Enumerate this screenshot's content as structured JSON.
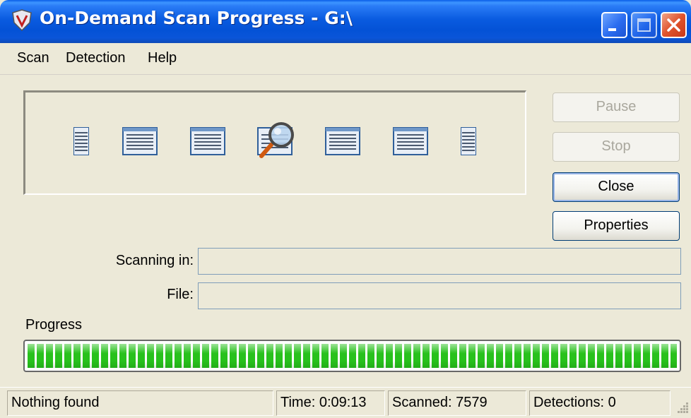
{
  "window": {
    "title": "On-Demand Scan Progress - G:\\",
    "app_icon": "mcafee-shield-icon",
    "caption_buttons": [
      "minimize-icon",
      "maximize-icon",
      "close-icon"
    ],
    "colors": {
      "titlebar": "#0a5be0",
      "close_button": "#e0532c",
      "face": "#ece9d8"
    }
  },
  "menu": {
    "items": [
      "Scan",
      "Detection",
      "Help"
    ]
  },
  "animation": {
    "icons": [
      "document-icon",
      "document-icon",
      "document-icon",
      "magnifier-document-icon",
      "document-icon",
      "document-icon",
      "document-icon"
    ]
  },
  "buttons": {
    "pause": "Pause",
    "stop": "Stop",
    "close": "Close",
    "properties": "Properties"
  },
  "fields": {
    "scanning_in_label": "Scanning in:",
    "scanning_in_value": "",
    "file_label": "File:",
    "file_value": ""
  },
  "progress": {
    "label": "Progress",
    "value_percent": 100,
    "color": "#28c11c"
  },
  "status": {
    "message": "Nothing found",
    "time": "Time: 0:09:13",
    "scanned": "Scanned: 7579",
    "detections": "Detections: 0"
  }
}
